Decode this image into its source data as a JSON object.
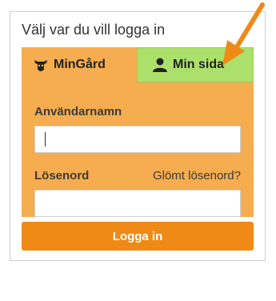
{
  "panel": {
    "title": "Välj var du vill logga in"
  },
  "tabs": [
    {
      "label": "MinGård",
      "icon": "cow-icon"
    },
    {
      "label": "Min sida",
      "icon": "person-icon"
    }
  ],
  "form": {
    "username_label": "Användarnamn",
    "username_value": "",
    "password_label": "Lösenord",
    "password_value": "",
    "forgot_label": "Glömt lösenord?",
    "login_label": "Logga in"
  },
  "colors": {
    "tab_mingard": "#f5ad4f",
    "tab_minsida": "#abe06b",
    "form_background": "#f5ad4f",
    "login_button": "#ef8a17",
    "arrow": "#ef8a17"
  }
}
